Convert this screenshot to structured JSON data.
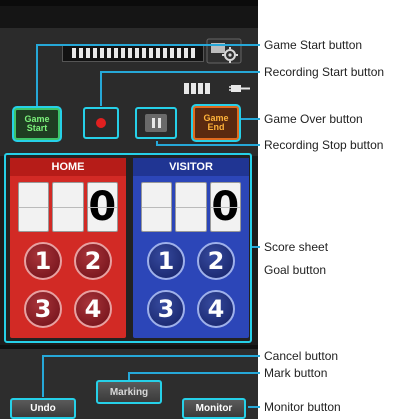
{
  "controls": {
    "game_start": "Game\nStart",
    "game_end": "Game\nEnd"
  },
  "score_sheet": {
    "home": {
      "label": "HOME",
      "score_digits": [
        "",
        "",
        "0"
      ],
      "goal_buttons": [
        "1",
        "2",
        "3",
        "4"
      ]
    },
    "visitor": {
      "label": "VISITOR",
      "score_digits": [
        "",
        "",
        "0"
      ],
      "goal_buttons": [
        "1",
        "2",
        "3",
        "4"
      ]
    }
  },
  "bottom": {
    "undo": "Undo",
    "marking": "Marking",
    "monitor": "Monitor"
  },
  "callouts": {
    "game_start": "Game Start button",
    "recording_start": "Recording Start button",
    "game_over": "Game Over button",
    "recording_stop": "Recording Stop button",
    "score_sheet": "Score sheet",
    "goal": "Goal button",
    "cancel": "Cancel button",
    "mark": "Mark button",
    "monitor": "Monitor button"
  },
  "colors": {
    "callout_accent": "#26d0e8",
    "home_panel": "#d22a25",
    "visitor_panel": "#2c46b8",
    "game_start_text": "#7cf27c",
    "game_end_text": "#ffb23a",
    "record_dot": "#e02020"
  },
  "icons": {
    "settings": "gear-icon",
    "power": "plug-icon",
    "record": "record-dot-icon",
    "pause": "pause-icon"
  }
}
